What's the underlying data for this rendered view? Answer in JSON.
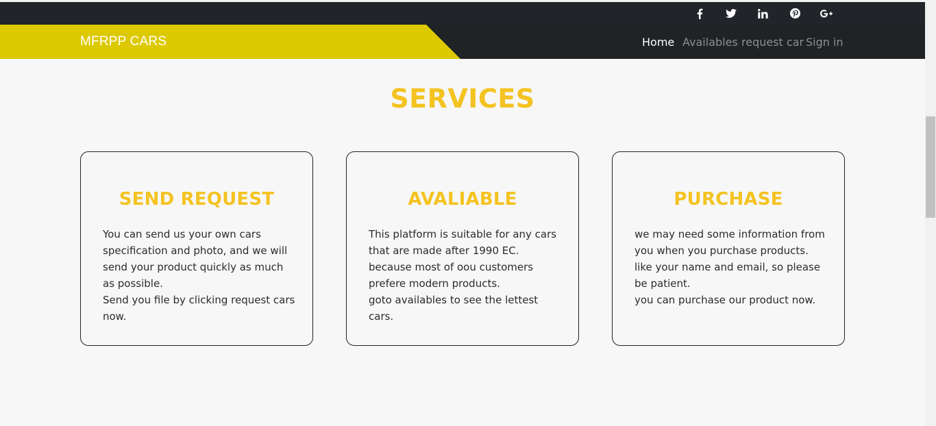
{
  "social": [
    {
      "icon": "facebook-icon"
    },
    {
      "icon": "twitter-icon"
    },
    {
      "icon": "linkedin-icon"
    },
    {
      "icon": "pinterest-icon"
    },
    {
      "icon": "google-plus-icon"
    }
  ],
  "header": {
    "brand": "MFRPP CARS",
    "nav": [
      {
        "label": "Home",
        "active": true
      },
      {
        "label": "Availables",
        "active": false
      },
      {
        "label": "request car",
        "active": false
      },
      {
        "label": "Sign in",
        "active": false
      }
    ]
  },
  "services": {
    "title": "SERVICES",
    "cards": [
      {
        "title": "SEND REQUEST",
        "paragraphs": [
          "You can send us your own cars specification and photo, and we will send your product quickly as much as possible.",
          "Send you file by clicking request cars now."
        ]
      },
      {
        "title": "AVALIABLE",
        "paragraphs": [
          "This platform is suitable for any cars that are made after 1990 EC. because most of oou customers prefere modern products.",
          "goto availables to see the lettest cars."
        ]
      },
      {
        "title": "PURCHASE",
        "paragraphs": [
          "we may need some information from you when you purchase products. like your name and email, so please be patient.",
          "you can purchase our product now."
        ]
      }
    ]
  },
  "colors": {
    "accent": "#f4c321",
    "brand_bg": "#ddc900",
    "nav_bg": "#1f2326",
    "page_bg": "#f7f7f7"
  }
}
